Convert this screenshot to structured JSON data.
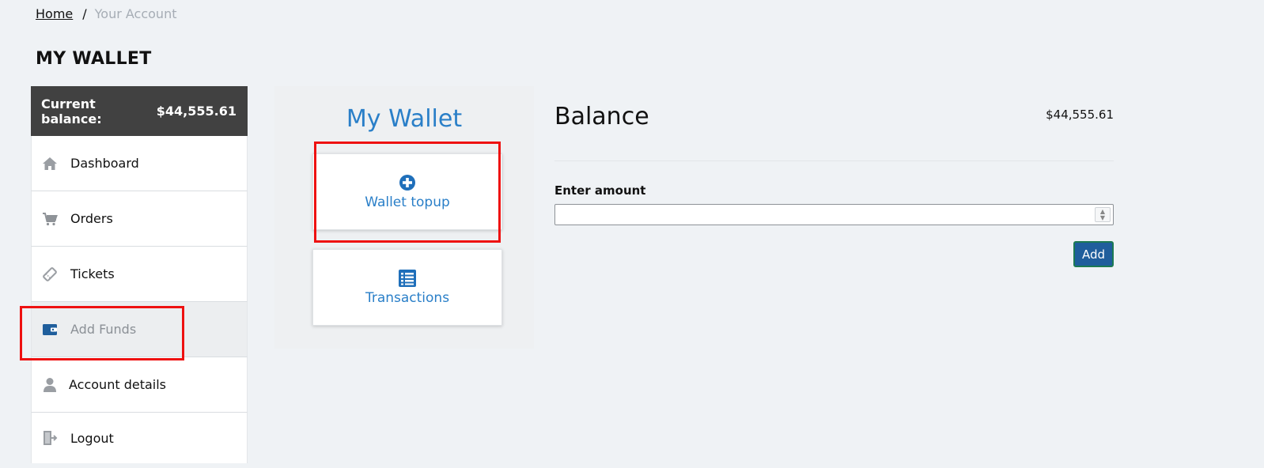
{
  "breadcrumb": {
    "home": "Home",
    "separator": "/",
    "current": "Your Account"
  },
  "page_title": "MY WALLET",
  "sidebar": {
    "balance_label": "Current balance:",
    "balance_value": "$44,555.61",
    "items": [
      {
        "label": "Dashboard",
        "icon": "home-icon"
      },
      {
        "label": "Orders",
        "icon": "cart-icon"
      },
      {
        "label": "Tickets",
        "icon": "ticket-icon"
      },
      {
        "label": "Add Funds",
        "icon": "wallet-icon",
        "active": true
      },
      {
        "label": "Account details",
        "icon": "user-icon"
      },
      {
        "label": "Logout",
        "icon": "logout-icon"
      }
    ]
  },
  "wallet": {
    "title": "My Wallet",
    "topup_label": "Wallet topup",
    "transactions_label": "Transactions"
  },
  "balance": {
    "heading": "Balance",
    "amount": "$44,555.61",
    "enter_amount_label": "Enter amount",
    "amount_value": "",
    "add_label": "Add"
  },
  "colors": {
    "accent_blue": "#2a7fc8",
    "dark_header": "#414141",
    "button_blue": "#1f5e9c",
    "highlight_red": "#ee1111",
    "icon_gray": "#9a9ea3",
    "wallet_icon_blue": "#1f5e9c"
  }
}
